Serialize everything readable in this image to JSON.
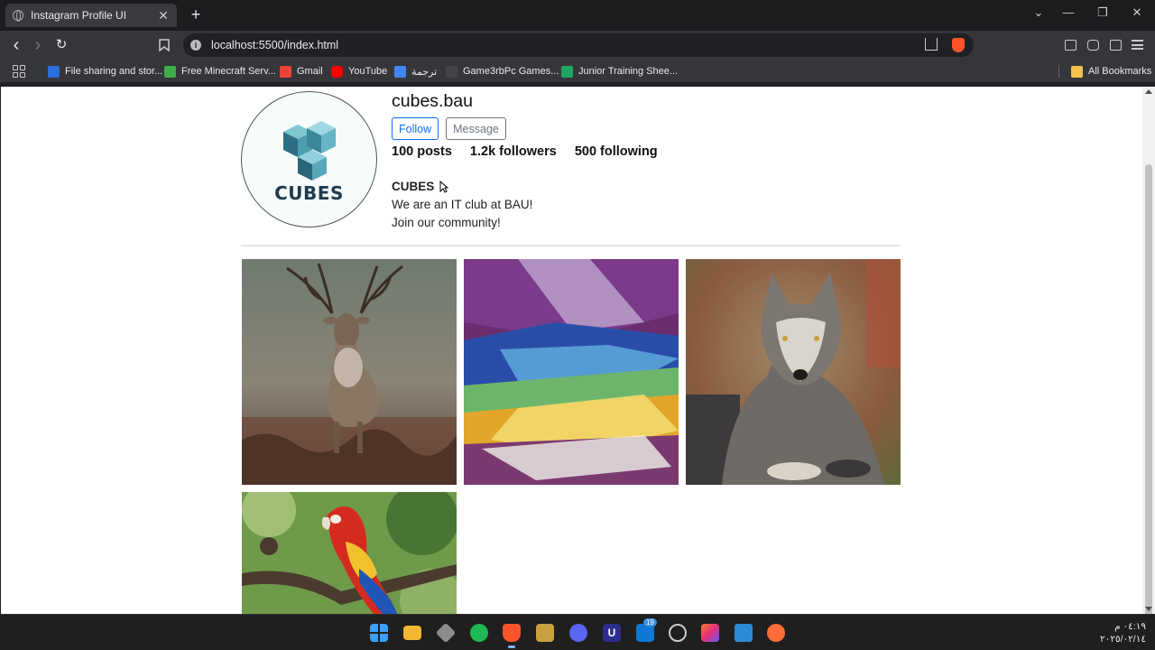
{
  "browser": {
    "tab_title": "Instagram Profile UI",
    "tab_close": "✕",
    "new_tab": "+",
    "window_controls": [
      "⌄",
      "—",
      "❐",
      "✕"
    ],
    "nav": {
      "back": "‹",
      "forward": "›",
      "reload": "↻",
      "bookmark_icon": "bookmark-icon"
    },
    "url": "localhost:5500/index.html",
    "bookmarks": [
      {
        "label": "File sharing and stor...",
        "color": "#2a6fdb"
      },
      {
        "label": "Free Minecraft Serv...",
        "color": "#3fae4b"
      },
      {
        "label": "Gmail",
        "color": "#ea4335"
      },
      {
        "label": "YouTube",
        "color": "#ff0000"
      },
      {
        "label": "ترجمة",
        "color": "#4285f4"
      },
      {
        "label": "Game3rbPc Games...",
        "color": "#444444"
      },
      {
        "label": "Junior Training Shee...",
        "color": "#1fa463"
      }
    ],
    "all_bookmarks": "All Bookmarks"
  },
  "profile": {
    "username": "cubes.bau",
    "avatar_logo_text": "CUBES",
    "follow_label": "Follow",
    "message_label": "Message",
    "stats": {
      "posts": "100 posts",
      "followers": "1.2k followers",
      "following": "500 following"
    },
    "bio": {
      "name": "CUBES",
      "line1": "We are an IT club at BAU!",
      "line2": "Join our community!"
    }
  },
  "posts": [
    {
      "subject": "deer"
    },
    {
      "subject": "abstract-painting"
    },
    {
      "subject": "wolf"
    },
    {
      "subject": "parrot"
    }
  ],
  "taskbar": {
    "icons": [
      "windows-start",
      "file-explorer",
      "unity",
      "spotify",
      "brave",
      "sublime",
      "discord",
      "ultraviewer",
      "outlook",
      "chrome-dev",
      "jetbrains",
      "vscode",
      "postman"
    ],
    "notification_badge": "19",
    "clock_time": "٠٤:١٩ م",
    "clock_date": "٢٠٢٥/٠٢/١٤"
  },
  "colors": {
    "follow_accent": "#0d6efd",
    "message_gray": "#6c757d",
    "browser_dark": "#35363a"
  }
}
